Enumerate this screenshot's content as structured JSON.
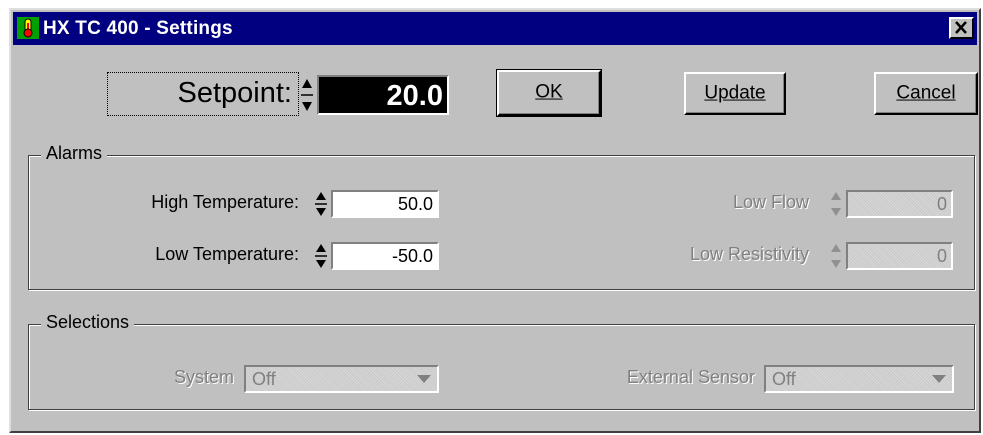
{
  "window": {
    "title": "HX TC 400 - Settings"
  },
  "setpoint": {
    "label": "Setpoint:",
    "value": "20.0"
  },
  "buttons": {
    "ok_label": "OK",
    "update_label": "Update",
    "cancel_label": "Cancel"
  },
  "alarms": {
    "legend": "Alarms",
    "high_temp_label": "High Temperature:",
    "high_temp_value": "50.0",
    "low_temp_label": "Low Temperature:",
    "low_temp_value": "-50.0",
    "low_flow_label": "Low Flow",
    "low_flow_value": "0",
    "low_resistivity_label": "Low Resistivity",
    "low_resistivity_value": "0"
  },
  "selections": {
    "legend": "Selections",
    "system_label": "System",
    "system_value": "Off",
    "external_sensor_label": "External Sensor",
    "external_sensor_value": "Off"
  },
  "colors": {
    "titlebar": "#000080",
    "window_face": "#c0c0c0",
    "setpoint_field": "#000000"
  },
  "icons": {
    "app": "thermometer-icon",
    "close": "close-icon",
    "spinners": "spin-up-down-icon",
    "combo": "dropdown-arrow-icon"
  }
}
